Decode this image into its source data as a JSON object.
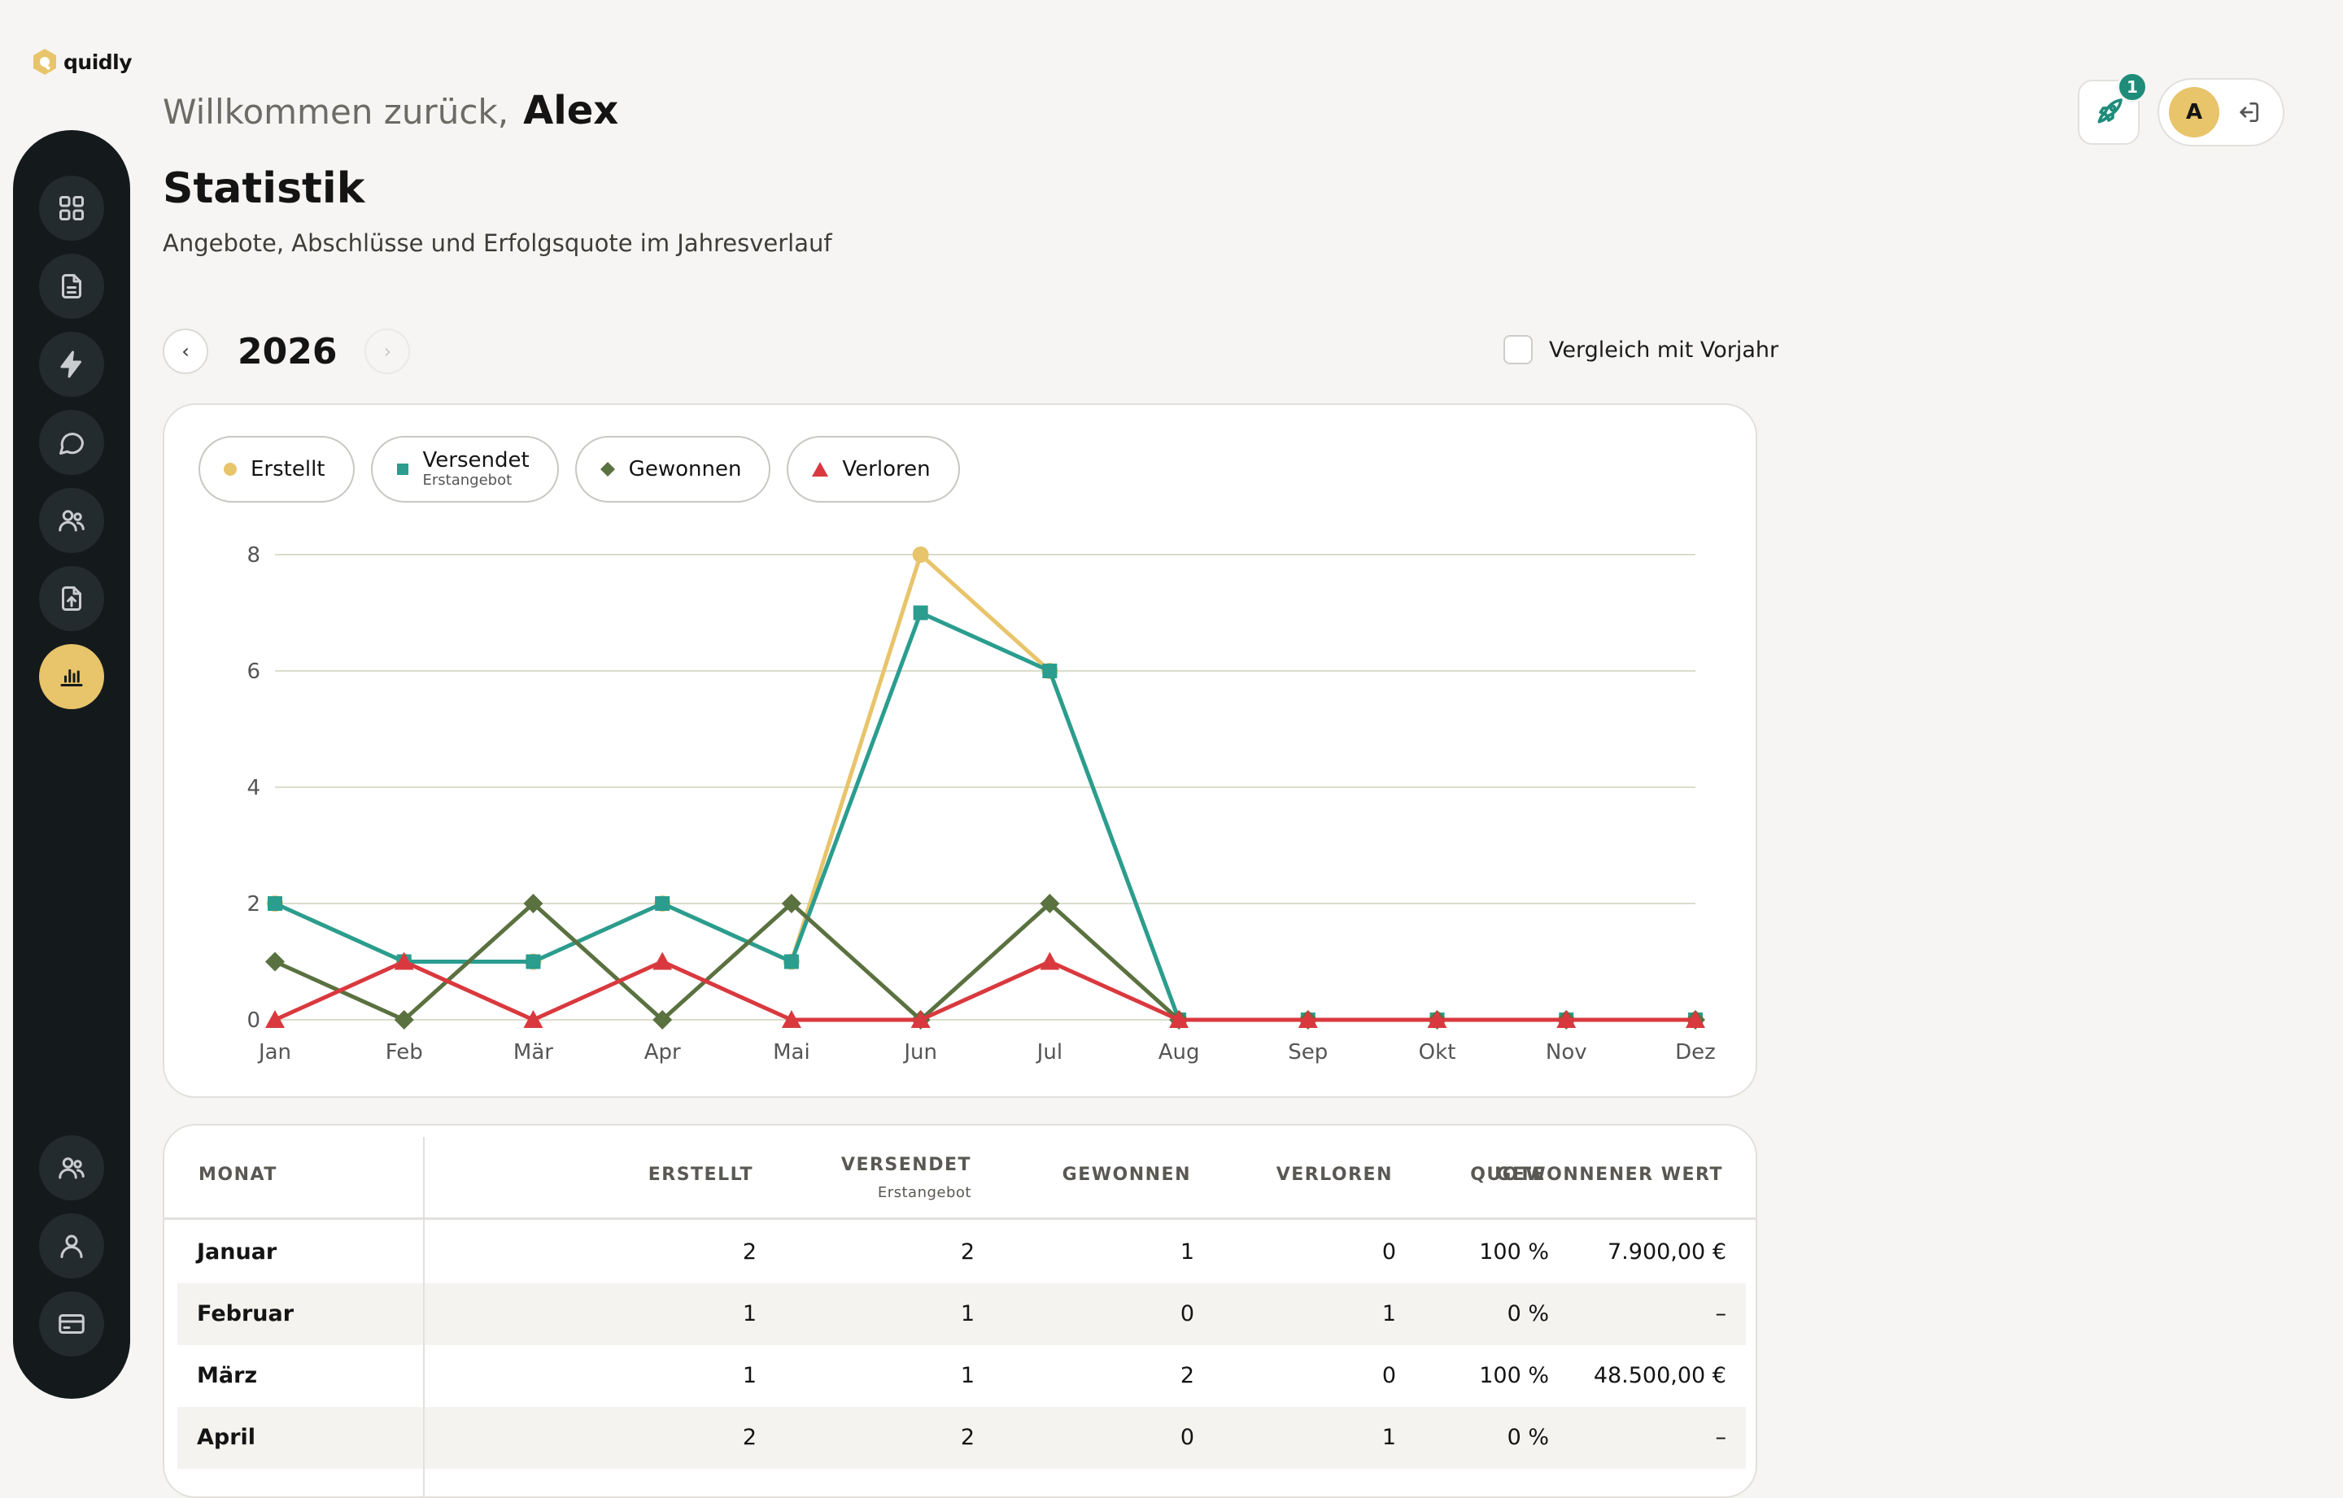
{
  "app": {
    "logo_text": "quidly"
  },
  "header": {
    "welcome_prefix": "Willkommen zurück,",
    "user_name": "Alex",
    "page_title": "Statistik",
    "page_subtitle": "Angebote, Abschlüsse und Erfolgsquote im Jahresverlauf",
    "notification_count": "1",
    "avatar_initial": "A"
  },
  "sidebar": {
    "items": [
      {
        "icon": "dashboard-icon"
      },
      {
        "icon": "document-icon"
      },
      {
        "icon": "lightning-icon"
      },
      {
        "icon": "chat-icon"
      },
      {
        "icon": "users-icon"
      },
      {
        "icon": "file-upload-icon"
      },
      {
        "icon": "bar-chart-icon",
        "active": true
      },
      {
        "icon": "team-icon"
      },
      {
        "icon": "user-icon"
      },
      {
        "icon": "credit-card-icon"
      }
    ]
  },
  "controls": {
    "year": "2026",
    "prev": "‹",
    "next": "›",
    "compare_label": "Vergleich mit Vorjahr",
    "compare_checked": false
  },
  "colors": {
    "erstellt": "#e8c46a",
    "versendet": "#2a9d8f",
    "gewonnen": "#5a7140",
    "verloren": "#d9393e",
    "accent": "#e8c46a",
    "sidebar": "#141a1c"
  },
  "chart_data": {
    "type": "line",
    "categories": [
      "Jan",
      "Feb",
      "Mär",
      "Apr",
      "Mai",
      "Jun",
      "Jul",
      "Aug",
      "Sep",
      "Okt",
      "Nov",
      "Dez"
    ],
    "yticks": [
      0,
      2,
      4,
      6,
      8
    ],
    "ylim": [
      0,
      8
    ],
    "grid": true,
    "legend_position": "top-left",
    "series": [
      {
        "name": "Erstellt",
        "marker": "circle",
        "color": "#e8c46a",
        "values": [
          2,
          1,
          1,
          2,
          1,
          8,
          6,
          0,
          0,
          0,
          0,
          0
        ]
      },
      {
        "name": "Versendet",
        "sub": "Erstangebot",
        "marker": "square",
        "color": "#2a9d8f",
        "values": [
          2,
          1,
          1,
          2,
          1,
          7,
          6,
          0,
          0,
          0,
          0,
          0
        ]
      },
      {
        "name": "Gewonnen",
        "marker": "diamond",
        "color": "#5a7140",
        "values": [
          1,
          0,
          2,
          0,
          2,
          0,
          2,
          0,
          0,
          0,
          0,
          0
        ]
      },
      {
        "name": "Verloren",
        "marker": "triangle",
        "color": "#d9393e",
        "values": [
          0,
          1,
          0,
          1,
          0,
          0,
          1,
          0,
          0,
          0,
          0,
          0
        ]
      }
    ]
  },
  "table": {
    "headers": {
      "monat": "MONAT",
      "erstellt": "ERSTELLT",
      "versendet": "VERSENDET",
      "versendet_sub": "Erstangebot",
      "gewonnen": "GEWONNEN",
      "verloren": "VERLOREN",
      "quote": "QUOTE",
      "wert": "GEWONNENER WERT"
    },
    "rows": [
      {
        "monat": "Januar",
        "erstellt": "2",
        "versendet": "2",
        "gewonnen": "1",
        "verloren": "0",
        "quote": "100 %",
        "wert": "7.900,00 €"
      },
      {
        "monat": "Februar",
        "erstellt": "1",
        "versendet": "1",
        "gewonnen": "0",
        "verloren": "1",
        "quote": "0 %",
        "wert": "–"
      },
      {
        "monat": "März",
        "erstellt": "1",
        "versendet": "1",
        "gewonnen": "2",
        "verloren": "0",
        "quote": "100 %",
        "wert": "48.500,00 €"
      },
      {
        "monat": "April",
        "erstellt": "2",
        "versendet": "2",
        "gewonnen": "0",
        "verloren": "1",
        "quote": "0 %",
        "wert": "–"
      }
    ]
  }
}
